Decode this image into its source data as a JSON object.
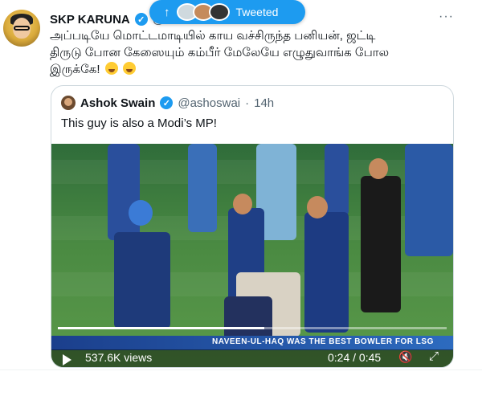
{
  "tweet": {
    "author_name": "SKP KARUNA",
    "author_handle": "@",
    "text_line1": "அப்படியே மொட்டமாடியில் காய வச்சிருந்த பனியன், ஜட்டி",
    "text_line2": "திருடு போன கேஸையும் கம்பீர் மேலேயே எழுதுவாங்க போல",
    "text_line3": "இருக்கே!",
    "emoji": [
      "weary-face-emoji",
      "weary-face-emoji"
    ],
    "more_label": "···"
  },
  "tweeted_pill": {
    "arrow": "↑",
    "label": "Tweeted"
  },
  "quote": {
    "author_name": "Ashok Swain",
    "author_handle": "@ashoswai",
    "separator": "·",
    "time": "14h",
    "text": "This guy is also a Modi’s MP!",
    "video": {
      "views": "537.6K views",
      "time": "0:24 / 0:45",
      "ad_text": "NAVEEN-UL-HAQ WAS THE BEST BOWLER FOR LSG",
      "progress_fraction": 0.53
    }
  },
  "colors": {
    "accent": "#1d9bf0",
    "text": "#0f1419",
    "muted": "#536471"
  }
}
